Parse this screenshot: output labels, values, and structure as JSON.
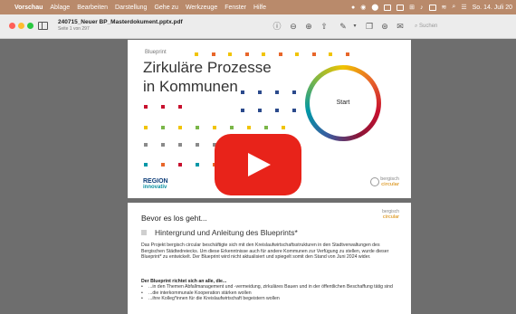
{
  "menubar": {
    "items": [
      "Vorschau",
      "Ablage",
      "Bearbeiten",
      "Darstellung",
      "Gehe zu",
      "Werkzeuge",
      "Fenster",
      "Hilfe"
    ],
    "clock": "So. 14. Juli 20"
  },
  "window": {
    "doc_title": "240715_Neuer BP_Masterdokument.pptx.pdf",
    "doc_subtitle": "Seite 1 von 297",
    "search_placeholder": "Suchen"
  },
  "slide1": {
    "label": "Blueprint",
    "title_line1": "Zirkuläre Prozesse",
    "title_line2": "in Kommunen",
    "start_label": "Start",
    "logo_region_line1": "REGION",
    "logo_region_line2": "innovativ",
    "logo_bc_line1": "bergisch",
    "logo_bc_line2": "circular"
  },
  "page2": {
    "logo_line1": "bergisch",
    "logo_line2": "circular",
    "heading": "Bevor es los geht...",
    "section_title": "Hintergrund und Anleitung des Blueprints*",
    "paragraph": "Das Projekt bergisch circular beschäftigte sich mit den Kreislaufwirtschaftsstrukturen in den Stadtverwaltungen des Bergischen Städtedreiecks. Um diese Erkenntnisse auch für andere Kommunen zur Verfügung zu stellen, wurde dieser Blueprint* zu entwickelt. Der Blueprint wird nicht aktualisiert und spiegelt somit den Stand von Juni 2024 wider.",
    "lead": "Der Blueprint richtet sich an alle, die...",
    "bullets": [
      "...in den Themen Abfallmanagement und -vermeidung, zirkuläres Bauen und in der öffentlichen Beschaffung tätig sind",
      "...die interkommunale Kooperation stärken wollen",
      "...ihre Kolleg*innen für die Kreislaufwirtschaft begeistern wollen"
    ]
  },
  "colors": {
    "menubar_bg": "#b98a6b",
    "play_button": "#e8231a",
    "accent_yellow": "#f1c400",
    "accent_orange": "#e8662a",
    "accent_red": "#c8102e",
    "accent_blue": "#2b4a8c",
    "accent_teal": "#0097a7",
    "accent_green": "#7ab648"
  }
}
